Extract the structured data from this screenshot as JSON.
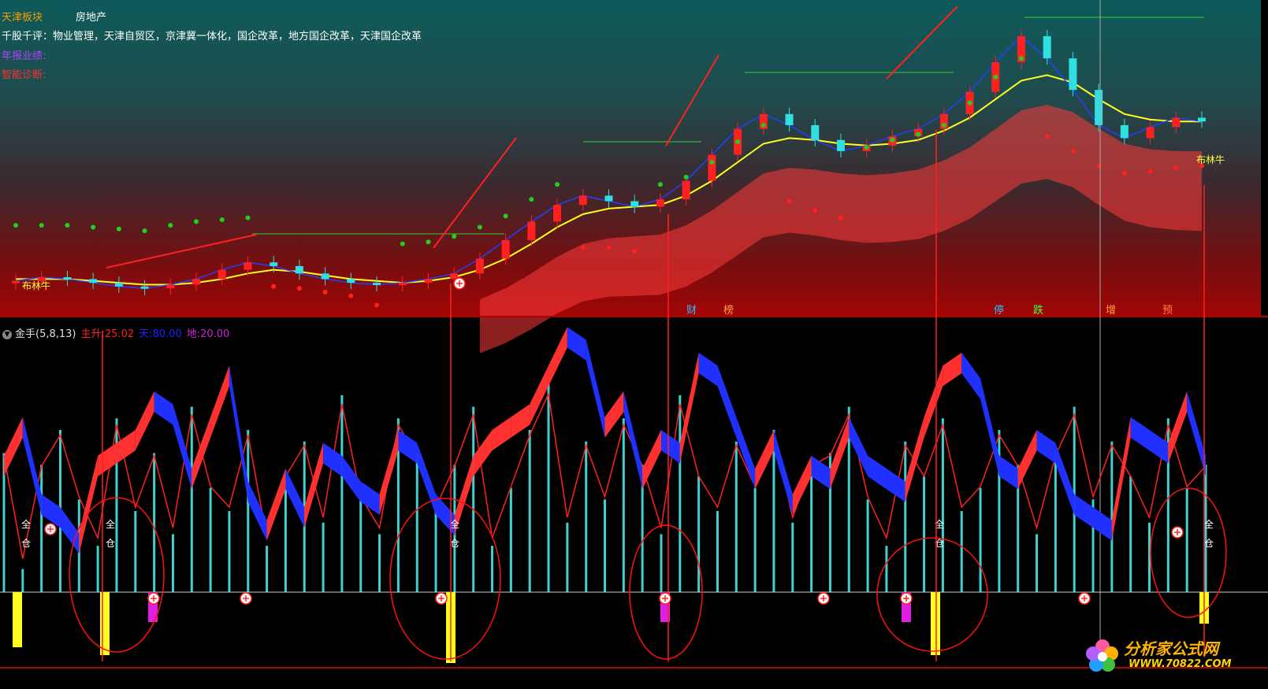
{
  "info": {
    "block_label": "天津板块",
    "block_value": "房地产",
    "comment": "千股千评：物业管理，天津自贸区，京津冀一体化，国企改革，地方国企改革，天津国企改革",
    "annual_label": "年报业绩:",
    "smart_label": "智能诊断:"
  },
  "indicator": {
    "name": "金手(5,8,13)",
    "items": [
      {
        "label": "主升:",
        "value": "25.02",
        "color": "#ff2020"
      },
      {
        "label": "天:",
        "value": "80.00",
        "color": "#2020ff"
      },
      {
        "label": "地:",
        "value": "20.00",
        "color": "#d020d0"
      }
    ]
  },
  "markers": {
    "full_position": "全仓",
    "bull_left": "布林牛",
    "bull_right": "布林牛",
    "events": [
      "财",
      "榜",
      "停",
      "跌",
      "增",
      "预"
    ]
  },
  "logo": {
    "main": "分析家公式网",
    "url": "WWW.70822.COM"
  },
  "colors": {
    "up": "#ff2020",
    "down": "#30e0e0",
    "ma_yellow": "#ffff20",
    "ma_blue": "#2040ff",
    "dot_green": "#20d020",
    "dot_red": "#ff2020",
    "bar_cyan": "#40d0d0",
    "bar_yellow": "#ffff20",
    "bar_magenta": "#e020e0"
  },
  "chart_data": {
    "type": "line",
    "upper": {
      "close": [
        4.2,
        4.4,
        4.3,
        4.1,
        3.9,
        3.8,
        4.0,
        4.3,
        4.8,
        5.2,
        5.0,
        4.6,
        4.3,
        4.1,
        4.0,
        4.1,
        4.3,
        4.6,
        5.4,
        6.4,
        7.4,
        8.3,
        8.8,
        8.5,
        8.2,
        8.6,
        9.6,
        11.0,
        12.4,
        13.2,
        12.6,
        11.8,
        11.2,
        11.5,
        12.0,
        12.4,
        13.2,
        14.4,
        16.0,
        17.4,
        16.2,
        14.5,
        12.6,
        11.9,
        12.5,
        13.0,
        12.8
      ],
      "ma": [
        4.3,
        4.3,
        4.3,
        4.2,
        4.1,
        4.0,
        4.0,
        4.1,
        4.3,
        4.6,
        4.8,
        4.7,
        4.5,
        4.3,
        4.2,
        4.1,
        4.2,
        4.4,
        4.8,
        5.4,
        6.2,
        7.1,
        7.8,
        8.1,
        8.2,
        8.3,
        8.8,
        9.6,
        10.6,
        11.6,
        11.9,
        11.8,
        11.6,
        11.5,
        11.6,
        11.8,
        12.3,
        13.0,
        14.0,
        15.0,
        15.3,
        14.9,
        14.0,
        13.2,
        12.9,
        12.8,
        12.8
      ],
      "dots": [
        5.0,
        5.0,
        5.0,
        4.9,
        4.8,
        4.7,
        5.0,
        5.2,
        5.3,
        5.4,
        5.5,
        5.4,
        5.2,
        5.0,
        4.5,
        4.0,
        4.1,
        4.4,
        4.9,
        5.5,
        6.4,
        7.2,
        7.6,
        7.6,
        7.4,
        7.2,
        7.6,
        8.4,
        9.5,
        10.4,
        10.1,
        9.6,
        9.2,
        9.2,
        9.6,
        9.9,
        10.4,
        11.6,
        13.0,
        14.0,
        13.6,
        12.8,
        12.0,
        11.6,
        11.7,
        11.9,
        12.0
      ],
      "dots_trend": [
        "down",
        "down",
        "down",
        "down",
        "down",
        "down",
        "down",
        "down",
        "down",
        "down",
        "up",
        "up",
        "up",
        "up",
        "up",
        "down",
        "down",
        "down",
        "down",
        "down",
        "down",
        "down",
        "up",
        "up",
        "up",
        "down",
        "down",
        "down",
        "down",
        "down",
        "up",
        "up",
        "up",
        "down",
        "down",
        "down",
        "down",
        "down",
        "down",
        "down",
        "up",
        "up",
        "up",
        "up",
        "up",
        "up",
        "up"
      ]
    },
    "lower": {
      "main": [
        45,
        60,
        30,
        25,
        15,
        45,
        50,
        55,
        70,
        65,
        40,
        60,
        80,
        35,
        20,
        40,
        25,
        50,
        45,
        35,
        30,
        55,
        50,
        30,
        22,
        45,
        55,
        60,
        65,
        80,
        95,
        90,
        60,
        70,
        40,
        55,
        50,
        85,
        80,
        60,
        40,
        55,
        30,
        45,
        40,
        60,
        45,
        40,
        35,
        60,
        80,
        85,
        75,
        45,
        40,
        55,
        50,
        30,
        25,
        20,
        60,
        55,
        50,
        70,
        45
      ],
      "bars": [
        60,
        10,
        55,
        70,
        40,
        20,
        75,
        35,
        60,
        25,
        80,
        45,
        35,
        70,
        20,
        50,
        65,
        30,
        85,
        40,
        25,
        75,
        60,
        35,
        55,
        80,
        20,
        45,
        70,
        90,
        30,
        65,
        40,
        75,
        55,
        25,
        85,
        50,
        35,
        65,
        45,
        70,
        30,
        55,
        60,
        80,
        40,
        20,
        65,
        50,
        75,
        35,
        45,
        70,
        55,
        25,
        60,
        80,
        40,
        65,
        50,
        30,
        75,
        45,
        55
      ],
      "base_levels": {
        "sky": 80,
        "ground": 20
      }
    }
  }
}
